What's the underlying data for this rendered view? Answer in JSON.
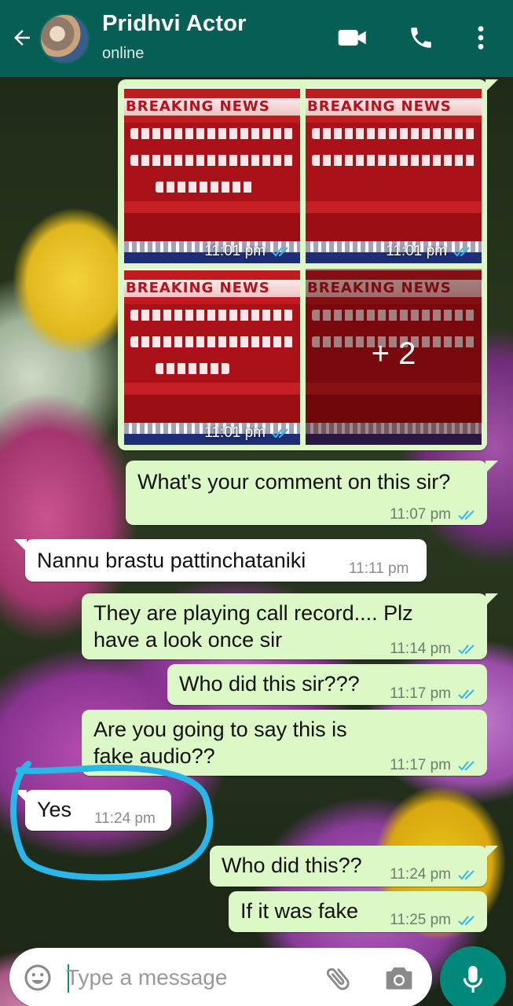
{
  "header": {
    "contact_name": "Pridhvi Actor",
    "status": "online",
    "color": "#075e54"
  },
  "media": {
    "tiles": [
      {
        "banner": "BREAKING NEWS",
        "time": "11:01 pm"
      },
      {
        "banner": "BREAKING NEWS",
        "time": "11:01 pm"
      },
      {
        "banner": "BREAKING NEWS",
        "time": "11:01 pm"
      },
      {
        "banner": "BREAKING NEWS",
        "more": "+ 2"
      }
    ]
  },
  "messages": [
    {
      "dir": "out",
      "text": "What's your comment on this sir?",
      "time": "11:07 pm"
    },
    {
      "dir": "in",
      "text": "Nannu brastu pattinchataniki",
      "time": "11:11 pm"
    },
    {
      "dir": "out",
      "text_line1": "They are playing call record.... Plz",
      "text_line2": "have a look once sir",
      "time": "11:14 pm"
    },
    {
      "dir": "out",
      "text": "Who did this sir???",
      "time": "11:17 pm"
    },
    {
      "dir": "out",
      "text_line1": "Are you going to say this is",
      "text_line2": "fake audio??",
      "time": "11:17 pm"
    },
    {
      "dir": "in",
      "text": "Yes",
      "time": "11:24 pm"
    },
    {
      "dir": "out",
      "text": "Who did this??",
      "time": "11:24 pm"
    },
    {
      "dir": "out",
      "text": "If it was fake",
      "time": "11:25 pm"
    }
  ],
  "composer": {
    "placeholder": "Type a message"
  },
  "colors": {
    "outgoing_bubble": "#dcf8c6",
    "incoming_bubble": "#ffffff",
    "read_ticks": "#34b7f1",
    "annotation": "#29b6e8",
    "mic_button": "#00897b"
  },
  "icons": [
    "back-arrow-icon",
    "video-call-icon",
    "phone-icon",
    "more-vert-icon",
    "emoji-icon",
    "attach-icon",
    "camera-icon",
    "mic-icon",
    "read-ticks-icon"
  ]
}
